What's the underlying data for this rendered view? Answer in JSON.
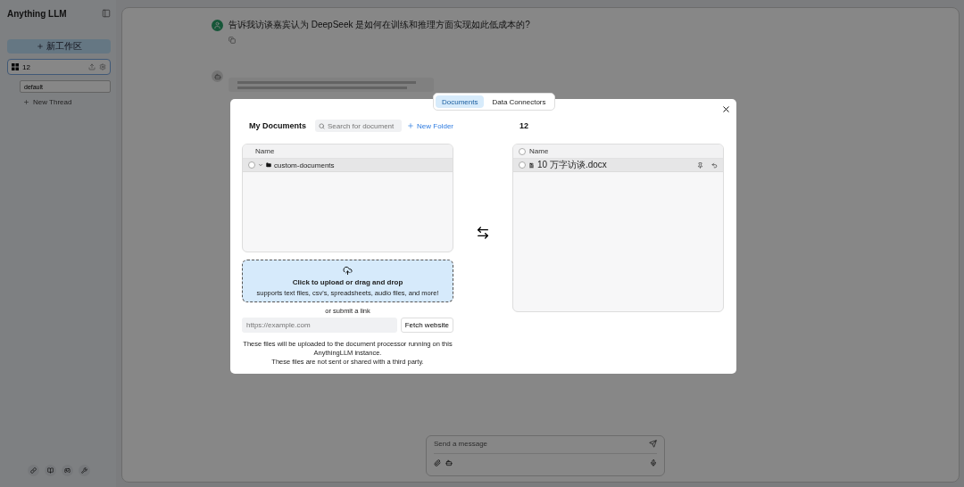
{
  "sidebar": {
    "brand": "Anything LLM",
    "new_workspace": "新工作区",
    "workspaces": [
      {
        "name": "12",
        "selected": true,
        "threads": [
          {
            "name": "default",
            "selected": true
          }
        ]
      }
    ],
    "new_thread": "New Thread"
  },
  "chat": {
    "question": "告诉我访谈嘉宾认为 DeepSeek 是如何在训练和推理方面实现如此低成本的?",
    "composer": {
      "placeholder": "Send a message"
    }
  },
  "modal": {
    "tabs": [
      {
        "label": "Documents",
        "selected": true
      },
      {
        "label": "Data Connectors",
        "selected": false
      }
    ],
    "title": "My Documents",
    "search": {
      "placeholder": "Search for document"
    },
    "new_folder": "New Folder",
    "my_documents": {
      "column": "Name",
      "rows": [
        {
          "name": "custom-documents",
          "kind": "folder",
          "checked": false
        }
      ]
    },
    "upload": {
      "title": "Click to upload or drag and drop",
      "hint": "supports text files, csv's, spreadsheets, audio files, and more!",
      "or_link": "or submit a link",
      "url_placeholder": "https://example.com",
      "fetch": "Fetch website",
      "notice": [
        "These files will be uploaded to the document processor running on this AnythingLLM instance.",
        "These files are not sent or shared with a third party."
      ]
    },
    "workspace": {
      "name": "12",
      "column": "Name",
      "rows": [
        {
          "name": "10 万字访谈.docx",
          "checked": false
        }
      ]
    }
  }
}
